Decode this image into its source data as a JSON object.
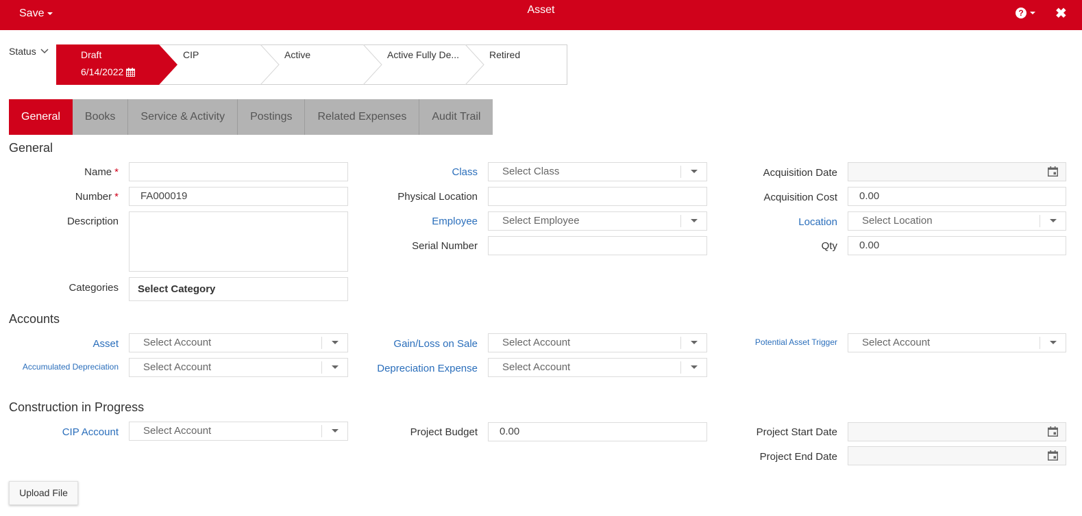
{
  "header": {
    "save_label": "Save",
    "title": "Asset",
    "help_glyph": "?",
    "close_glyph": "✖",
    "color": "#d0021b"
  },
  "status": {
    "label": "Status",
    "stages": [
      {
        "name": "Draft",
        "date": "6/14/2022",
        "active": true
      },
      {
        "name": "CIP"
      },
      {
        "name": "Active"
      },
      {
        "name": "Active Fully De..."
      },
      {
        "name": "Retired"
      }
    ]
  },
  "tabs": [
    "General",
    "Books",
    "Service & Activity",
    "Postings",
    "Related Expenses",
    "Audit Trail"
  ],
  "general": {
    "title": "General",
    "name_label": "Name",
    "number_label": "Number",
    "number_value": "FA000019",
    "description_label": "Description",
    "categories_label": "Categories",
    "categories_value": "Select Category",
    "class_label": "Class",
    "class_placeholder": "Select Class",
    "physical_location_label": "Physical Location",
    "employee_label": "Employee",
    "employee_placeholder": "Select Employee",
    "serial_number_label": "Serial Number",
    "acquisition_date_label": "Acquisition Date",
    "acquisition_cost_label": "Acquisition Cost",
    "acquisition_cost_value": "0.00",
    "location_label": "Location",
    "location_placeholder": "Select Location",
    "qty_label": "Qty",
    "qty_value": "0.00",
    "required_marker": "*"
  },
  "accounts": {
    "title": "Accounts",
    "asset_label": "Asset",
    "accumulated_depreciation_label": "Accumulated Depreciation",
    "gain_loss_label": "Gain/Loss on Sale",
    "depreciation_expense_label": "Depreciation Expense",
    "potential_asset_trigger_label": "Potential Asset Trigger",
    "select_account_placeholder": "Select Account"
  },
  "cip": {
    "title": "Construction in Progress",
    "cip_account_label": "CIP Account",
    "cip_account_placeholder": "Select Account",
    "project_budget_label": "Project Budget",
    "project_budget_value": "0.00",
    "project_start_date_label": "Project Start Date",
    "project_end_date_label": "Project End Date"
  },
  "upload_label": "Upload File"
}
